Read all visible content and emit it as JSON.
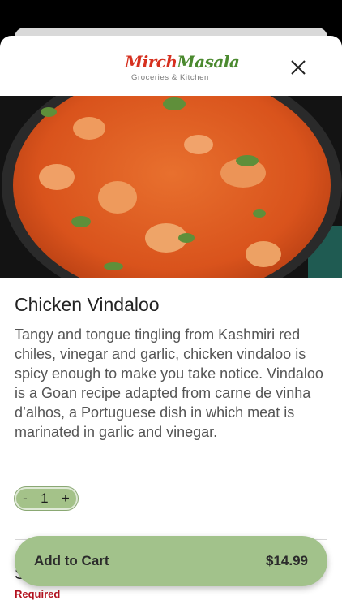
{
  "header": {
    "logo_word1": "Mirch",
    "logo_word2": "Masala",
    "logo_tagline": "Groceries & Kitchen"
  },
  "item": {
    "title": "Chicken Vindaloo",
    "description": "Tangy and tongue tingling from Kashmiri red chiles, vinegar and garlic, chicken vindaloo is spicy enough to make you take notice. Vindaloo is a Goan recipe adapted from carne de vinha d’alhos, a Portuguese dish in which meat is marinated in garlic and vinegar."
  },
  "quantity": {
    "minus": "-",
    "value": "1",
    "plus": "+"
  },
  "options": {
    "section_label": "S",
    "required": "Required"
  },
  "cart": {
    "label": "Add to Cart",
    "price": "$14.99"
  },
  "colors": {
    "brand_red": "#d6301f",
    "brand_green": "#4b8a2f",
    "button_green": "#a2c28b",
    "required_red": "#b3121f"
  }
}
